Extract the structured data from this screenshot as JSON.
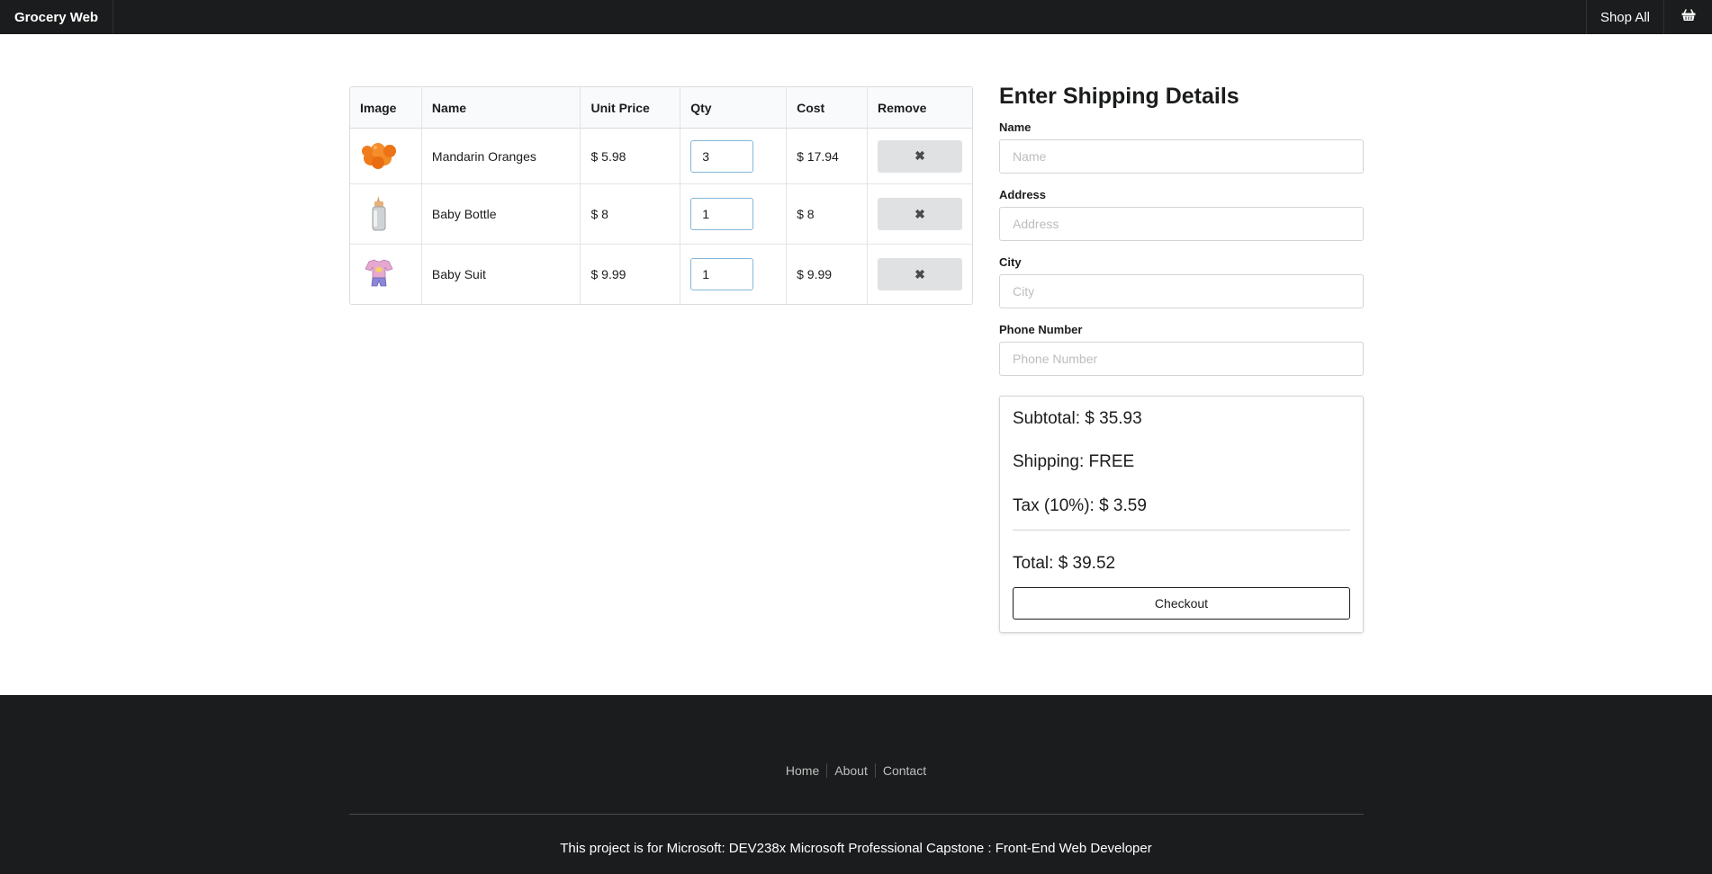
{
  "navbar": {
    "brand": "Grocery Web",
    "shop_all": "Shop All",
    "cart_icon": "basket-icon"
  },
  "cart": {
    "columns": [
      "Image",
      "Name",
      "Unit Price",
      "Qty",
      "Cost",
      "Remove"
    ],
    "items": [
      {
        "image_icon": "oranges-icon",
        "name": "Mandarin Oranges",
        "unit_price": "$ 5.98",
        "qty": "3",
        "cost": "$ 17.94",
        "remove_icon": "close-icon"
      },
      {
        "image_icon": "baby-bottle-icon",
        "name": "Baby Bottle",
        "unit_price": "$ 8",
        "qty": "1",
        "cost": "$ 8",
        "remove_icon": "close-icon"
      },
      {
        "image_icon": "baby-suit-icon",
        "name": "Baby Suit",
        "unit_price": "$ 9.99",
        "qty": "1",
        "cost": "$ 9.99",
        "remove_icon": "close-icon"
      }
    ]
  },
  "shipping": {
    "heading": "Enter Shipping Details",
    "fields": [
      {
        "label": "Name",
        "placeholder": "Name",
        "value": ""
      },
      {
        "label": "Address",
        "placeholder": "Address",
        "value": ""
      },
      {
        "label": "City",
        "placeholder": "City",
        "value": ""
      },
      {
        "label": "Phone Number",
        "placeholder": "Phone Number",
        "value": ""
      }
    ]
  },
  "summary": {
    "subtotal": "Subtotal: $ 35.93",
    "shipping": "Shipping: FREE",
    "tax": "Tax (10%): $ 3.59",
    "total": "Total: $ 39.52",
    "checkout_label": "Checkout"
  },
  "footer": {
    "links": [
      "Home",
      "About",
      "Contact"
    ],
    "note": "This project is for Microsoft: DEV238x Microsoft Professional Capstone : Front-End Web Developer"
  },
  "colors": {
    "navbar_bg": "#1b1c1d",
    "footer_bg": "#1b1c1d",
    "qty_border": "#85b7d9",
    "remove_bg": "#e0e1e2"
  }
}
